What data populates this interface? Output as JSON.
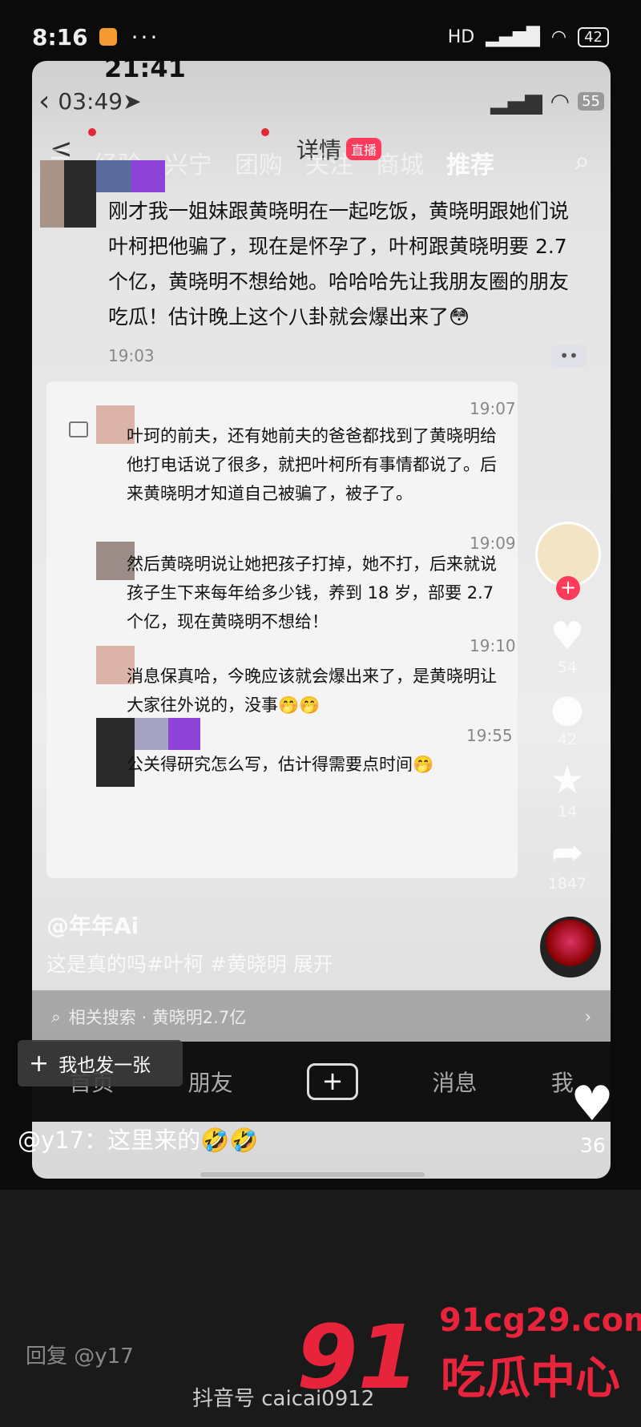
{
  "status_bar": {
    "time": "8:16",
    "dots": "···",
    "network": "HD",
    "battery": "42"
  },
  "screenshot": {
    "inner_time_top": "21:41",
    "inner_status_time": "03:49",
    "inner_battery": "55",
    "back_glyph": "<",
    "page_title": "详情",
    "tabs": [
      "经验",
      "兴宁",
      "团购",
      "关注",
      "商城",
      "推荐"
    ],
    "live_badge": "直播",
    "chat": {
      "main_message": "刚才我一姐妹跟黄晓明在一起吃饭，黄晓明跟她们说叶柯把他骗了，现在是怀孕了，叶柯跟黄晓明要 2.7 个亿，黄晓明不想给她。哈哈哈先让我朋友圈的朋友吃瓜！估计晚上这个八卦就会爆出来了😳",
      "main_time": "19:03",
      "replies": [
        {
          "time": "19:07",
          "text": "叶珂的前夫，还有她前夫的爸爸都找到了黄晓明给他打电话说了很多，就把叶柯所有事情都说了。后来黄晓明才知道自己被骗了，被子了。"
        },
        {
          "time": "19:09",
          "text": "然后黄晓明说让她把孩子打掉，她不打，后来就说孩子生下来每年给多少钱，养到 18 岁，部要 2.7 个亿，现在黄晓明不想给！"
        },
        {
          "time": "19:10",
          "text": "消息保真哈，今晚应该就会爆出来了，是黄晓明让大家往外说的，没事🤭🤭"
        },
        {
          "time": "19:55",
          "text": "公关得研究怎么写，估计得需要点时间🤭"
        }
      ]
    },
    "sidebar": {
      "like_count": "54",
      "comment_count": "42",
      "fav_count": "14",
      "share_count": "1847"
    },
    "author": "@年年Ai",
    "description": "这是真的吗#叶柯 #黄晓明  展开",
    "related_search": "相关搜索 · 黄晓明2.7亿"
  },
  "bottom_nav": {
    "items": [
      "首页",
      "朋友",
      "消息",
      "我"
    ],
    "plus": "+"
  },
  "overlay": {
    "post_button": "我也发一张",
    "heart_count": "36",
    "comment": "@y17：这里来的🤣🤣",
    "reply_placeholder": "回复 @y17"
  },
  "watermark": {
    "big": "91",
    "url": "91cg29.com",
    "name": "吃瓜中心",
    "douyin_id": "抖音号 caicai0912"
  },
  "colors": {
    "accent_red": "#e8243d",
    "live_red": "#ff3b5c",
    "page_bg": "#0b0b0b"
  }
}
